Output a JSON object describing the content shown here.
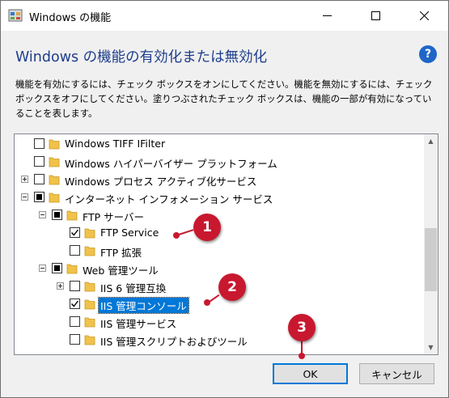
{
  "window": {
    "title": "Windows の機能"
  },
  "heading": "Windows の機能の有効化または無効化",
  "help_label": "?",
  "description": "機能を有効にするには、チェック ボックスをオンにしてください。機能を無効にするには、チェック ボックスをオフにしてください。塗りつぶされたチェック ボックスは、機能の一部が有効になっていることを表します。",
  "tree": [
    {
      "label": "Windows TIFF IFilter",
      "state": "unchecked",
      "expander": "none"
    },
    {
      "label": "Windows ハイパーバイザー プラットフォーム",
      "state": "unchecked",
      "expander": "none"
    },
    {
      "label": "Windows プロセス アクティブ化サービス",
      "state": "unchecked",
      "expander": "plus"
    },
    {
      "label": "インターネット インフォメーション サービス",
      "state": "partial",
      "expander": "minus"
    },
    {
      "label": "FTP サーバー",
      "state": "partial",
      "expander": "minus"
    },
    {
      "label": "FTP Service",
      "state": "checked",
      "expander": "none"
    },
    {
      "label": "FTP 拡張",
      "state": "unchecked",
      "expander": "none"
    },
    {
      "label": "Web 管理ツール",
      "state": "partial",
      "expander": "minus"
    },
    {
      "label": "IIS 6 管理互換",
      "state": "unchecked",
      "expander": "plus"
    },
    {
      "label": "IIS 管理コンソール",
      "state": "checked",
      "expander": "none",
      "selected": true
    },
    {
      "label": "IIS 管理サービス",
      "state": "unchecked",
      "expander": "none"
    },
    {
      "label": "IIS 管理スクリプトおよびツール",
      "state": "unchecked",
      "expander": "none"
    }
  ],
  "buttons": {
    "ok": "OK",
    "cancel": "キャンセル"
  },
  "badges": [
    "1",
    "2",
    "3"
  ],
  "colors": {
    "accent": "#0078d7",
    "badge": "#c8182f",
    "heading": "#1e3e8c"
  }
}
